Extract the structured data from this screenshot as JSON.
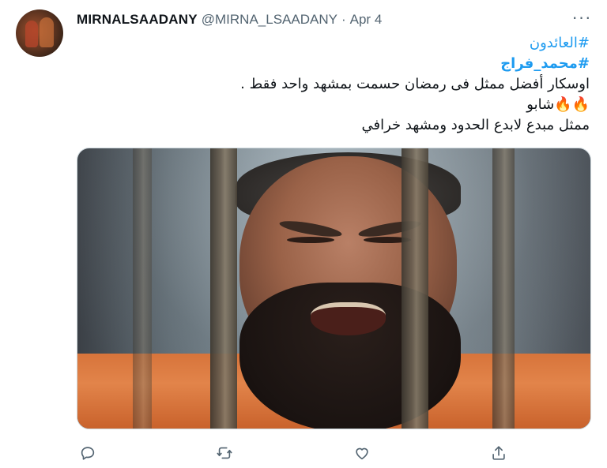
{
  "tweet": {
    "author_name": "MIRNALSAADANY",
    "author_handle": "@MIRNA_LSAADANY",
    "separator": "·",
    "date": "Apr 4",
    "lines": {
      "hashtag1": "#العائدون",
      "hashtag2": "#محمد_فراج",
      "text1": "اوسكار أفضل ممثل فى رمضان حسمت بمشهد واحد فقط .",
      "text2": "🔥🔥شابو",
      "text3": "ممثل مبدع لابدع الحدود ومشهد خرافي"
    }
  },
  "icons": {
    "more": "more-horizontal-icon",
    "reply": "reply-icon",
    "retweet": "retweet-icon",
    "like": "heart-icon",
    "share": "share-icon"
  },
  "colors": {
    "hashtag": "#1d9bf0",
    "secondary_text": "#536471",
    "primary_text": "#0f1419"
  }
}
